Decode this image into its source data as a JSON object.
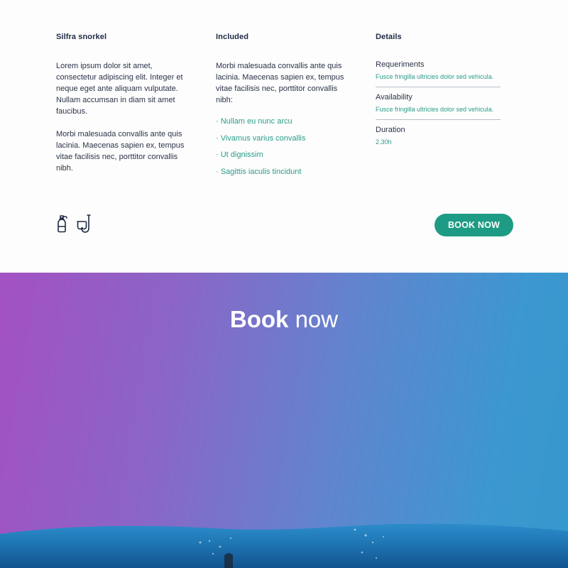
{
  "columns": {
    "snorkel": {
      "title": "Silfra snorkel",
      "paragraphs": [
        "Lorem ipsum dolor sit amet, consectetur adipiscing elit. Integer et neque eget ante aliquam vulputate. Nullam accumsan in diam sit amet faucibus.",
        "Morbi malesuada convallis ante quis lacinia. Maecenas sapien ex, tempus vitae facilisis nec, porttitor convallis nibh."
      ]
    },
    "included": {
      "title": "Included",
      "intro": "Morbi malesuada convallis ante quis lacinia. Maecenas sapien ex, tempus vitae facilisis nec, porttitor convallis nibh:",
      "items": [
        "· Nullam eu nunc arcu",
        "· Vivamus varius convallis",
        "· Ut dignissim",
        "· Sagittis iaculis tincidunt"
      ]
    },
    "details": {
      "title": "Details",
      "items": [
        {
          "label": "Requeriments",
          "value": "Fusce fringilla ultricies dolor sed vehicula."
        },
        {
          "label": "Availability",
          "value": "Fusce fringilla ultricies dolor sed vehicula."
        },
        {
          "label": "Duration",
          "value": "2.30h"
        }
      ]
    }
  },
  "icons": [
    "oxygen-tank-icon",
    "snorkel-mask-icon"
  ],
  "book_button": {
    "label": "BOOK NOW"
  },
  "hero": {
    "title_strong": "Book",
    "title_light": "now"
  },
  "colors": {
    "accent": "#1e9b84",
    "accent_text": "#2a9c8a",
    "text": "#1f2a44",
    "gradient_start": "#a351c2",
    "gradient_end": "#3599cd",
    "sea": "#1d73b0"
  }
}
